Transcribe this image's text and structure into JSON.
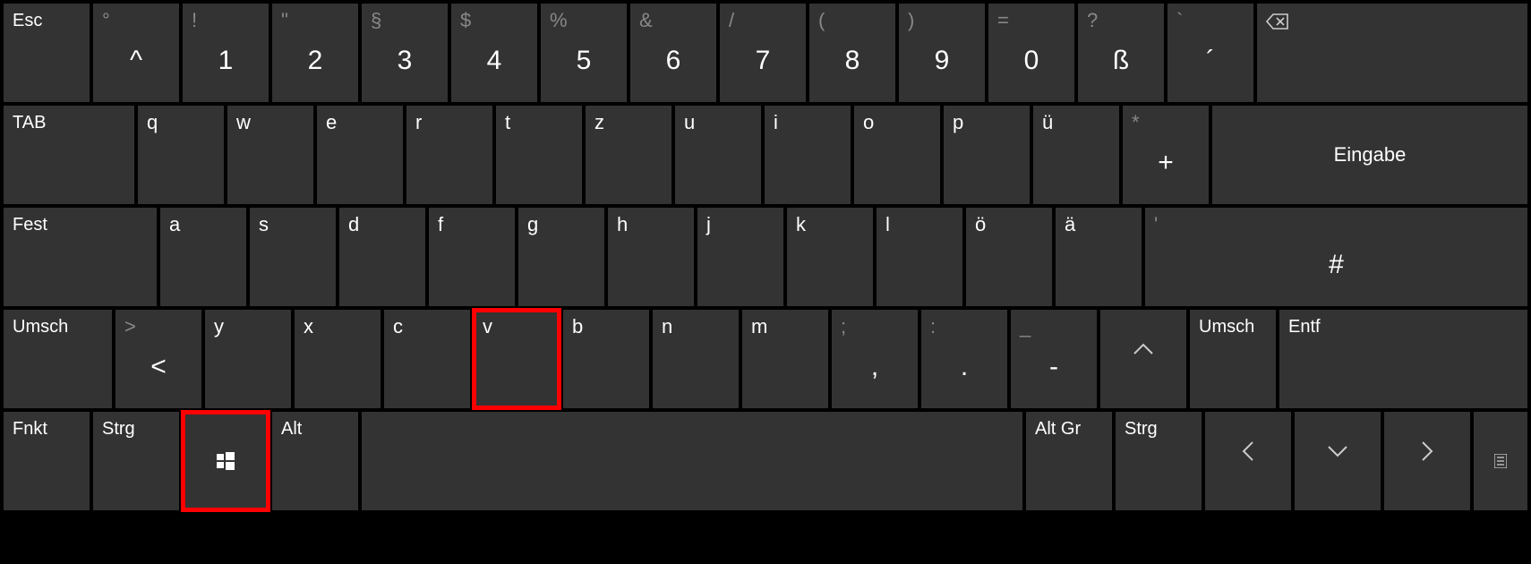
{
  "row0": {
    "esc": "Esc",
    "circumflex_shift": "°",
    "circumflex": "^",
    "k1_shift": "!",
    "k1": "1",
    "k2_shift": "\"",
    "k2": "2",
    "k3_shift": "§",
    "k3": "3",
    "k4_shift": "$",
    "k4": "4",
    "k5_shift": "%",
    "k5": "5",
    "k6_shift": "&",
    "k6": "6",
    "k7_shift": "/",
    "k7": "7",
    "k8_shift": "(",
    "k8": "8",
    "k9_shift": ")",
    "k9": "9",
    "k0_shift": "=",
    "k0": "0",
    "ss_shift": "?",
    "ss": "ß",
    "acute_shift": "`",
    "acute": "´"
  },
  "row1": {
    "tab": "TAB",
    "q": "q",
    "w": "w",
    "e": "e",
    "r": "r",
    "t": "t",
    "z": "z",
    "u": "u",
    "i": "i",
    "o": "o",
    "p": "p",
    "ue": "ü",
    "plus_shift": "*",
    "plus": "+",
    "enter": "Eingabe"
  },
  "row2": {
    "caps": "Fest",
    "a": "a",
    "s": "s",
    "d": "d",
    "f": "f",
    "g": "g",
    "h": "h",
    "j": "j",
    "k": "k",
    "l": "l",
    "oe": "ö",
    "ae": "ä",
    "hash_shift": "'",
    "hash": "#"
  },
  "row3": {
    "shift_l": "Umsch",
    "lt_shift": ">",
    "lt": "<",
    "y": "y",
    "x": "x",
    "c": "c",
    "v": "v",
    "b": "b",
    "n": "n",
    "m": "m",
    "comma_shift": ";",
    "comma": ",",
    "period_shift": ":",
    "period": ".",
    "minus_shift": "_",
    "minus": "-",
    "up": "︿",
    "shift_r": "Umsch",
    "del": "Entf"
  },
  "row4": {
    "fn": "Fnkt",
    "ctrl_l": "Strg",
    "alt": "Alt",
    "altgr": "Alt Gr",
    "ctrl_r": "Strg",
    "left": "〈",
    "down": "﹀",
    "right": "〉"
  }
}
